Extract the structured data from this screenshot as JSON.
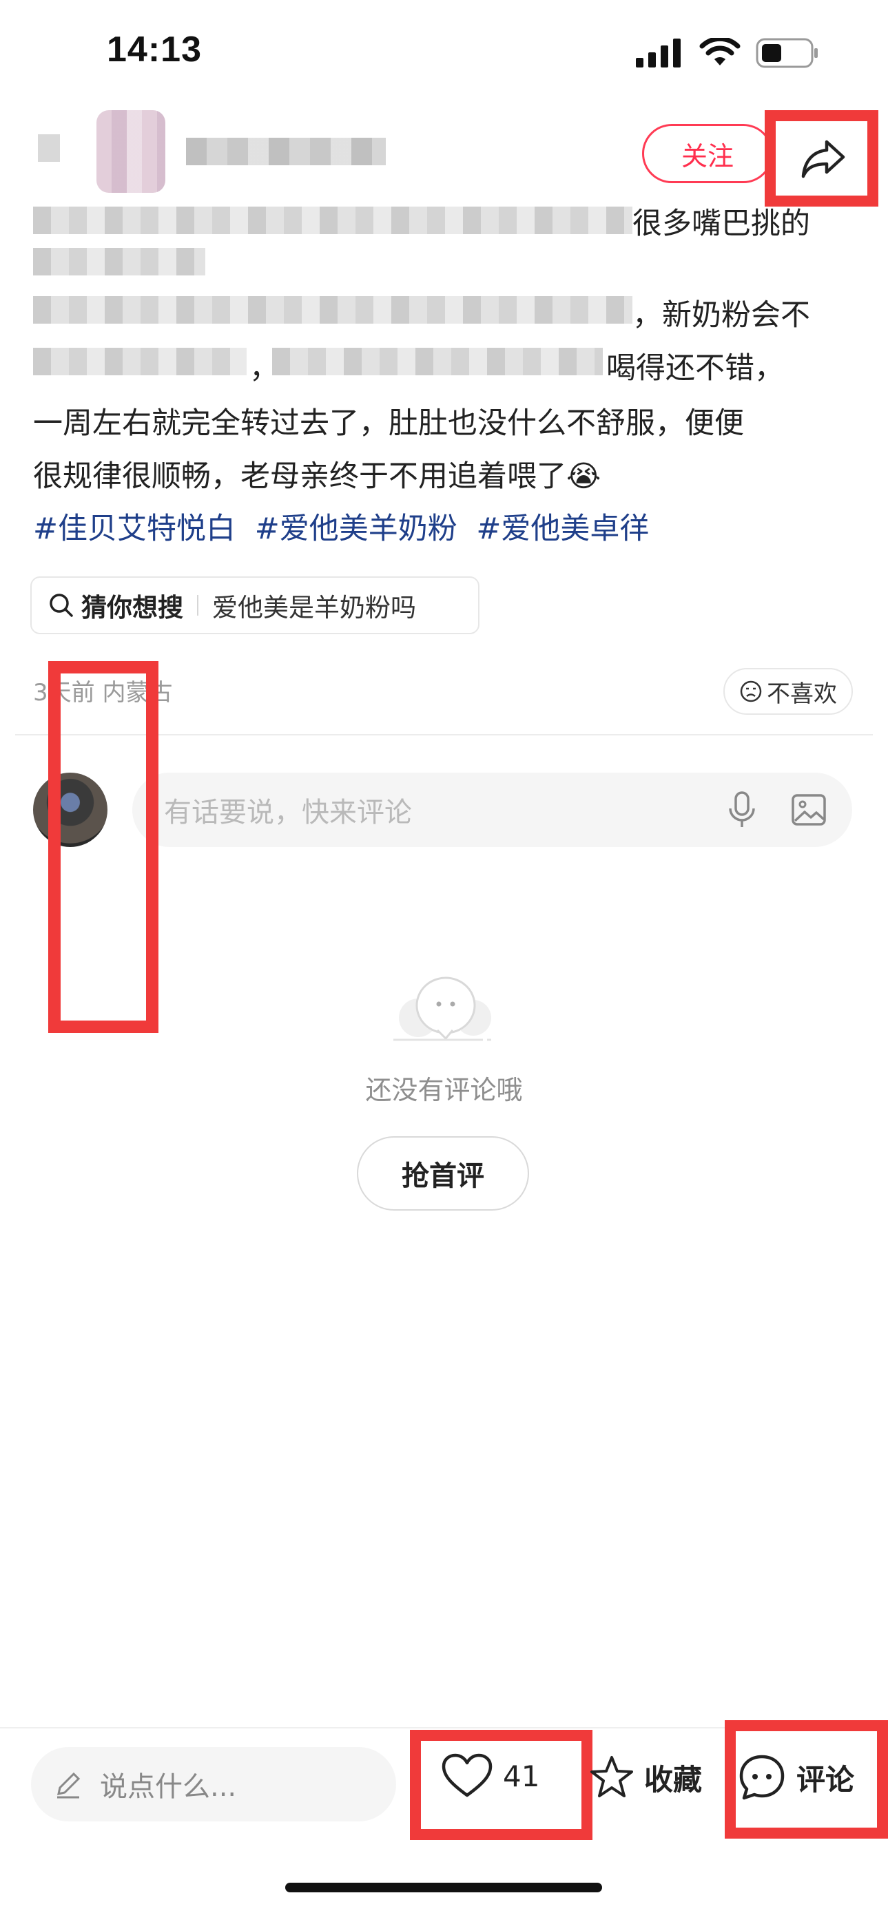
{
  "status_bar": {
    "time": "14:13"
  },
  "header": {
    "follow_label": "关注"
  },
  "post": {
    "line1_tail": "很多嘴巴挑的",
    "line3_tail": "，新奶粉会不",
    "line4_mid": "，",
    "line4_tail": "喝得还不错，",
    "line5": "一周左右就完全转过去了，肚肚也没什么不舒服，便便",
    "line6": "很规律很顺畅，老母亲终于不用追着喂了😭",
    "hashtags": [
      "#佳贝艾特悦白",
      "#爱他美羊奶粉",
      "#爱他美卓徉"
    ]
  },
  "search_suggest": {
    "title": "猜你想搜",
    "query": "爱他美是羊奶粉吗"
  },
  "meta": {
    "time_location": "3天前 内蒙古",
    "dislike_label": "不喜欢"
  },
  "comment_input": {
    "placeholder": "有话要说，快来评论"
  },
  "empty_state": {
    "text": "还没有评论哦",
    "button_label": "抢首评"
  },
  "bottom_bar": {
    "say_placeholder": "说点什么...",
    "like_count": "41",
    "collect_label": "收藏",
    "comment_label": "评论"
  },
  "colors": {
    "accent": "#ff2e4d",
    "hashtag": "#1f3f8a",
    "highlight": "#f03a3a"
  },
  "icons": [
    "share-icon",
    "search-icon",
    "dislike-face-icon",
    "mic-icon",
    "image-icon",
    "chat-bubble-icon",
    "pencil-icon",
    "heart-icon",
    "star-icon",
    "comment-icon"
  ]
}
